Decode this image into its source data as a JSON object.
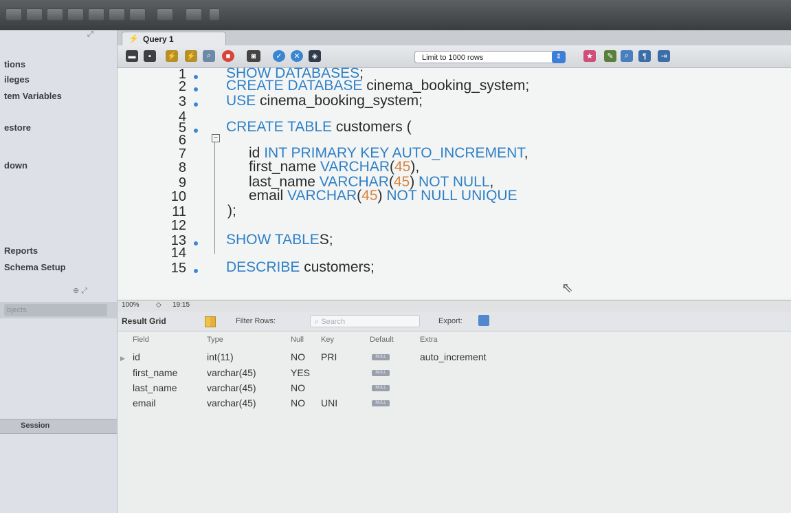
{
  "tab": {
    "title": "Query 1"
  },
  "sidebar": {
    "items": [
      {
        "label": "tions",
        "name": "sidebar-item-connections"
      },
      {
        "label": "ileges",
        "name": "sidebar-item-privileges"
      },
      {
        "label": "tem Variables",
        "name": "sidebar-item-system-variables"
      },
      {
        "label": "estore",
        "name": "sidebar-item-restore"
      },
      {
        "label": "down",
        "name": "sidebar-item-shutdown"
      },
      {
        "label": "Reports",
        "name": "sidebar-item-reports"
      },
      {
        "label": "Schema Setup",
        "name": "sidebar-item-schema-setup"
      }
    ],
    "objects_placeholder": "bjects",
    "session_label": "Session"
  },
  "toolbar": {
    "limit_label": "Limit to 1000 rows"
  },
  "editor": {
    "lines": [
      {
        "no": "1",
        "dot": true,
        "text": "SHOW DATABASES;"
      },
      {
        "no": "2",
        "dot": true,
        "text": "CREATE DATABASE cinema_booking_system;"
      },
      {
        "no": "3",
        "dot": true,
        "text": "USE cinema_booking_system;"
      },
      {
        "no": "4",
        "dot": false,
        "text": ""
      },
      {
        "no": "5",
        "dot": true,
        "text": "CREATE TABLE customers ("
      },
      {
        "no": "6",
        "dot": false,
        "text": ""
      },
      {
        "no": "7",
        "dot": false,
        "text": "id INT PRIMARY KEY AUTO_INCREMENT,"
      },
      {
        "no": "8",
        "dot": false,
        "text": "first_name VARCHAR(45),"
      },
      {
        "no": "9",
        "dot": false,
        "text": "last_name VARCHAR(45) NOT NULL,"
      },
      {
        "no": "10",
        "dot": false,
        "text": "email VARCHAR(45) NOT NULL UNIQUE"
      },
      {
        "no": "11",
        "dot": false,
        "text": ");"
      },
      {
        "no": "12",
        "dot": false,
        "text": ""
      },
      {
        "no": "13",
        "dot": true,
        "text": "SHOW TABLES;"
      },
      {
        "no": "14",
        "dot": false,
        "text": ""
      },
      {
        "no": "15",
        "dot": true,
        "text": "DESCRIBE customers;"
      }
    ]
  },
  "status": {
    "zoom": "100%",
    "cursor": "19:15"
  },
  "results": {
    "tab_label": "Result Grid",
    "filter_label": "Filter Rows:",
    "search_placeholder": "Search",
    "export_label": "Export:",
    "columns": [
      "Field",
      "Type",
      "Null",
      "Key",
      "Default",
      "Extra"
    ],
    "null_badge": "NULL",
    "rows": [
      {
        "field": "id",
        "type": "int(11)",
        "null": "NO",
        "key": "PRI",
        "extra": "auto_increment"
      },
      {
        "field": "first_name",
        "type": "varchar(45)",
        "null": "YES",
        "key": "",
        "extra": ""
      },
      {
        "field": "last_name",
        "type": "varchar(45)",
        "null": "NO",
        "key": "",
        "extra": ""
      },
      {
        "field": "email",
        "type": "varchar(45)",
        "null": "NO",
        "key": "UNI",
        "extra": ""
      }
    ]
  },
  "colors": {
    "keyword": "#2f7fc6",
    "number": "#d8833e",
    "accent": "#3b7fd9"
  },
  "icons": [
    "folder-icon",
    "save-icon",
    "execute-icon",
    "execute-current-icon",
    "explain-icon",
    "stop-icon",
    "toggle-output-icon",
    "commit-icon",
    "rollback-icon",
    "autocommit-icon",
    "beautify-icon",
    "find-icon",
    "invisible-chars-icon",
    "wrap-icon"
  ]
}
